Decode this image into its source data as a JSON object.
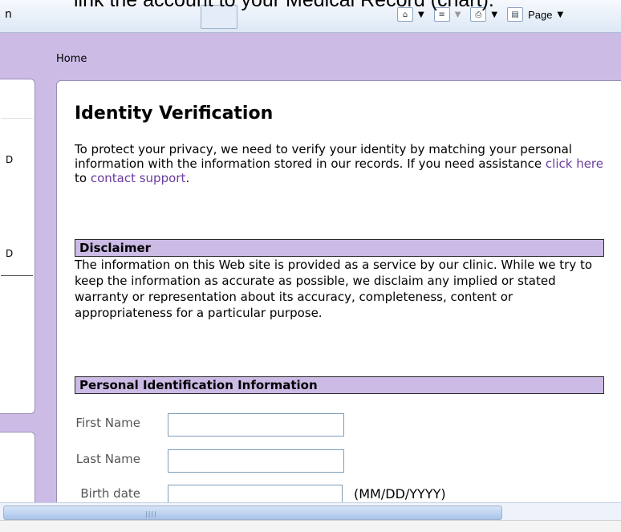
{
  "caption": "link the account to your Medical Record (chart).",
  "ie": {
    "left_text": "n",
    "page_label": "Page"
  },
  "breadcrumb": "Home",
  "left_panel": {
    "fragments": [
      "D",
      "D"
    ]
  },
  "main": {
    "title": "Identity Verification",
    "intro_before": "To protect your privacy, we need to verify your identity by matching your personal information with the information stored in our records. If you need assistance ",
    "link_click_here": "click here",
    "intro_middle": " to ",
    "link_contact_support": "contact support",
    "intro_after": ".",
    "disclaimer_heading": "Disclaimer",
    "disclaimer_text": "The information on this Web site is provided as a service by our clinic. While we try to keep the information as accurate as possible, we disclaim any implied or stated warranty or representation about its accuracy, completeness, content or appropriateness for a particular purpose.",
    "pii_heading": "Personal Identification Information",
    "fields": {
      "first_name_label": "First Name",
      "first_name_value": "",
      "last_name_label": "Last Name",
      "last_name_value": "",
      "birth_date_label": "Birth date",
      "birth_date_value": "",
      "birth_date_hint": "(MM/DD/YYYY)"
    }
  },
  "icons": [
    "home-icon",
    "feeds-icon",
    "print-icon",
    "page-icon"
  ]
}
